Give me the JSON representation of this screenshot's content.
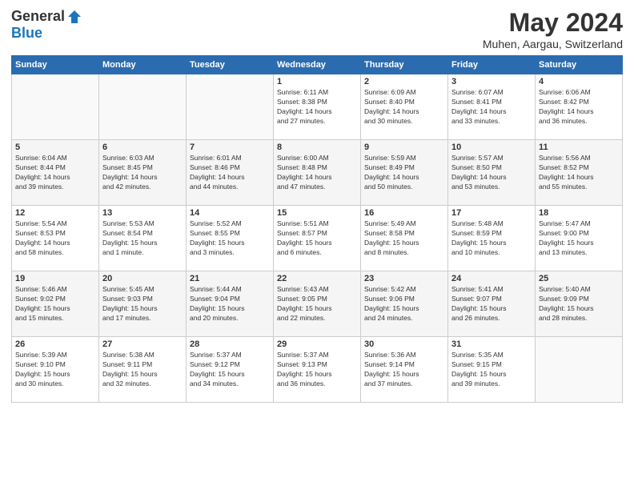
{
  "logo": {
    "general": "General",
    "blue": "Blue"
  },
  "title": "May 2024",
  "location": "Muhen, Aargau, Switzerland",
  "headers": [
    "Sunday",
    "Monday",
    "Tuesday",
    "Wednesday",
    "Thursday",
    "Friday",
    "Saturday"
  ],
  "weeks": [
    [
      {
        "day": "",
        "info": ""
      },
      {
        "day": "",
        "info": ""
      },
      {
        "day": "",
        "info": ""
      },
      {
        "day": "1",
        "info": "Sunrise: 6:11 AM\nSunset: 8:38 PM\nDaylight: 14 hours\nand 27 minutes."
      },
      {
        "day": "2",
        "info": "Sunrise: 6:09 AM\nSunset: 8:40 PM\nDaylight: 14 hours\nand 30 minutes."
      },
      {
        "day": "3",
        "info": "Sunrise: 6:07 AM\nSunset: 8:41 PM\nDaylight: 14 hours\nand 33 minutes."
      },
      {
        "day": "4",
        "info": "Sunrise: 6:06 AM\nSunset: 8:42 PM\nDaylight: 14 hours\nand 36 minutes."
      }
    ],
    [
      {
        "day": "5",
        "info": "Sunrise: 6:04 AM\nSunset: 8:44 PM\nDaylight: 14 hours\nand 39 minutes."
      },
      {
        "day": "6",
        "info": "Sunrise: 6:03 AM\nSunset: 8:45 PM\nDaylight: 14 hours\nand 42 minutes."
      },
      {
        "day": "7",
        "info": "Sunrise: 6:01 AM\nSunset: 8:46 PM\nDaylight: 14 hours\nand 44 minutes."
      },
      {
        "day": "8",
        "info": "Sunrise: 6:00 AM\nSunset: 8:48 PM\nDaylight: 14 hours\nand 47 minutes."
      },
      {
        "day": "9",
        "info": "Sunrise: 5:59 AM\nSunset: 8:49 PM\nDaylight: 14 hours\nand 50 minutes."
      },
      {
        "day": "10",
        "info": "Sunrise: 5:57 AM\nSunset: 8:50 PM\nDaylight: 14 hours\nand 53 minutes."
      },
      {
        "day": "11",
        "info": "Sunrise: 5:56 AM\nSunset: 8:52 PM\nDaylight: 14 hours\nand 55 minutes."
      }
    ],
    [
      {
        "day": "12",
        "info": "Sunrise: 5:54 AM\nSunset: 8:53 PM\nDaylight: 14 hours\nand 58 minutes."
      },
      {
        "day": "13",
        "info": "Sunrise: 5:53 AM\nSunset: 8:54 PM\nDaylight: 15 hours\nand 1 minute."
      },
      {
        "day": "14",
        "info": "Sunrise: 5:52 AM\nSunset: 8:55 PM\nDaylight: 15 hours\nand 3 minutes."
      },
      {
        "day": "15",
        "info": "Sunrise: 5:51 AM\nSunset: 8:57 PM\nDaylight: 15 hours\nand 6 minutes."
      },
      {
        "day": "16",
        "info": "Sunrise: 5:49 AM\nSunset: 8:58 PM\nDaylight: 15 hours\nand 8 minutes."
      },
      {
        "day": "17",
        "info": "Sunrise: 5:48 AM\nSunset: 8:59 PM\nDaylight: 15 hours\nand 10 minutes."
      },
      {
        "day": "18",
        "info": "Sunrise: 5:47 AM\nSunset: 9:00 PM\nDaylight: 15 hours\nand 13 minutes."
      }
    ],
    [
      {
        "day": "19",
        "info": "Sunrise: 5:46 AM\nSunset: 9:02 PM\nDaylight: 15 hours\nand 15 minutes."
      },
      {
        "day": "20",
        "info": "Sunrise: 5:45 AM\nSunset: 9:03 PM\nDaylight: 15 hours\nand 17 minutes."
      },
      {
        "day": "21",
        "info": "Sunrise: 5:44 AM\nSunset: 9:04 PM\nDaylight: 15 hours\nand 20 minutes."
      },
      {
        "day": "22",
        "info": "Sunrise: 5:43 AM\nSunset: 9:05 PM\nDaylight: 15 hours\nand 22 minutes."
      },
      {
        "day": "23",
        "info": "Sunrise: 5:42 AM\nSunset: 9:06 PM\nDaylight: 15 hours\nand 24 minutes."
      },
      {
        "day": "24",
        "info": "Sunrise: 5:41 AM\nSunset: 9:07 PM\nDaylight: 15 hours\nand 26 minutes."
      },
      {
        "day": "25",
        "info": "Sunrise: 5:40 AM\nSunset: 9:09 PM\nDaylight: 15 hours\nand 28 minutes."
      }
    ],
    [
      {
        "day": "26",
        "info": "Sunrise: 5:39 AM\nSunset: 9:10 PM\nDaylight: 15 hours\nand 30 minutes."
      },
      {
        "day": "27",
        "info": "Sunrise: 5:38 AM\nSunset: 9:11 PM\nDaylight: 15 hours\nand 32 minutes."
      },
      {
        "day": "28",
        "info": "Sunrise: 5:37 AM\nSunset: 9:12 PM\nDaylight: 15 hours\nand 34 minutes."
      },
      {
        "day": "29",
        "info": "Sunrise: 5:37 AM\nSunset: 9:13 PM\nDaylight: 15 hours\nand 36 minutes."
      },
      {
        "day": "30",
        "info": "Sunrise: 5:36 AM\nSunset: 9:14 PM\nDaylight: 15 hours\nand 37 minutes."
      },
      {
        "day": "31",
        "info": "Sunrise: 5:35 AM\nSunset: 9:15 PM\nDaylight: 15 hours\nand 39 minutes."
      },
      {
        "day": "",
        "info": ""
      }
    ]
  ]
}
